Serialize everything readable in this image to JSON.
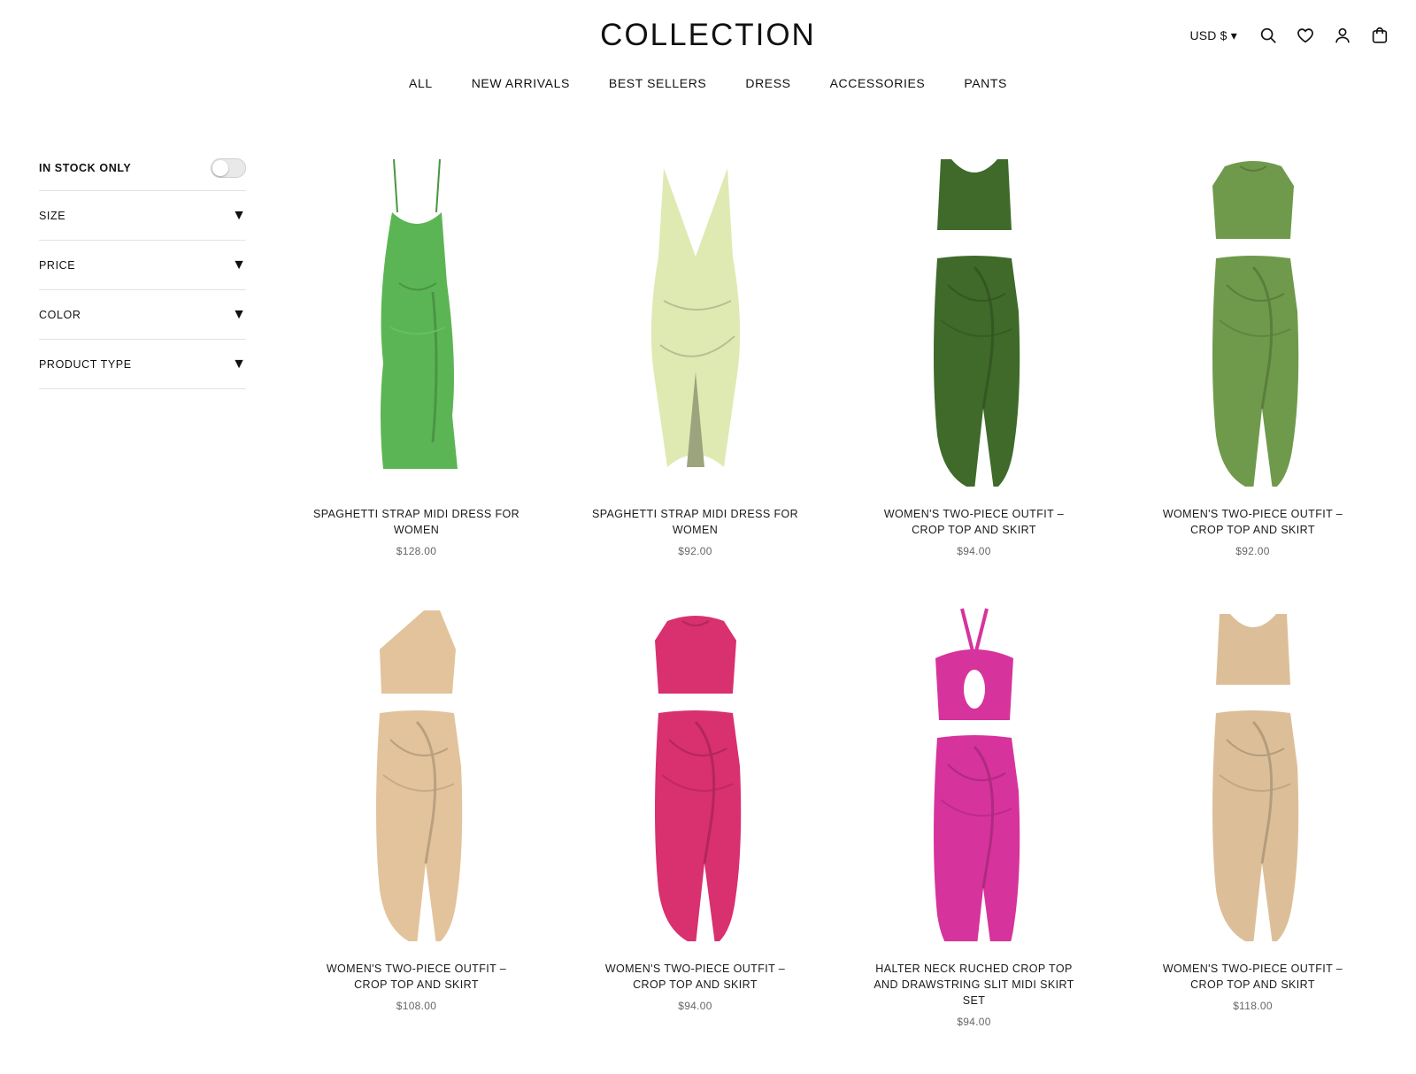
{
  "brand": "COLLECTION",
  "header": {
    "currency": "USD $ ▾",
    "icons": [
      "search-icon",
      "heart-icon",
      "user-icon",
      "cart-icon"
    ]
  },
  "nav": [
    "ALL",
    "NEW ARRIVALS",
    "BEST SELLERS",
    "DRESS",
    "ACCESSORIES",
    "PANTS"
  ],
  "filters": {
    "in_stock_label": "IN STOCK ONLY",
    "in_stock_on": false,
    "caret": "▼",
    "items": [
      "SIZE",
      "PRICE",
      "COLOR",
      "PRODUCT TYPE"
    ]
  },
  "products": [
    {
      "title": "SPAGHETTI STRAP MIDI DRESS FOR WOMEN",
      "price": "$128.00",
      "kind": "dress",
      "color": "#5cb554"
    },
    {
      "title": "SPAGHETTI STRAP MIDI DRESS FOR WOMEN",
      "price": "$92.00",
      "kind": "dress-v",
      "color": "#dfeab3"
    },
    {
      "title": "WOMEN'S TWO-PIECE OUTFIT – CROP TOP AND SKIRT",
      "price": "$94.00",
      "kind": "set-tank",
      "color": "#3f6a2a"
    },
    {
      "title": "WOMEN'S TWO-PIECE OUTFIT – CROP TOP AND SKIRT",
      "price": "$92.00",
      "kind": "set-crew",
      "color": "#6f9a4b"
    },
    {
      "title": "WOMEN'S TWO-PIECE OUTFIT – CROP TOP AND SKIRT",
      "price": "$108.00",
      "kind": "set-oneshoulder",
      "color": "#e3c39c"
    },
    {
      "title": "WOMEN'S TWO-PIECE OUTFIT – CROP TOP AND SKIRT",
      "price": "$94.00",
      "kind": "set-crew",
      "color": "#d9306f"
    },
    {
      "title": "HALTER NECK RUCHED CROP TOP AND DRAWSTRING SLIT MIDI SKIRT SET",
      "price": "$94.00",
      "kind": "set-halter",
      "color": "#d6339c"
    },
    {
      "title": "WOMEN'S TWO-PIECE OUTFIT – CROP TOP AND SKIRT",
      "price": "$118.00",
      "kind": "set-tank",
      "color": "#dcbf99"
    }
  ]
}
